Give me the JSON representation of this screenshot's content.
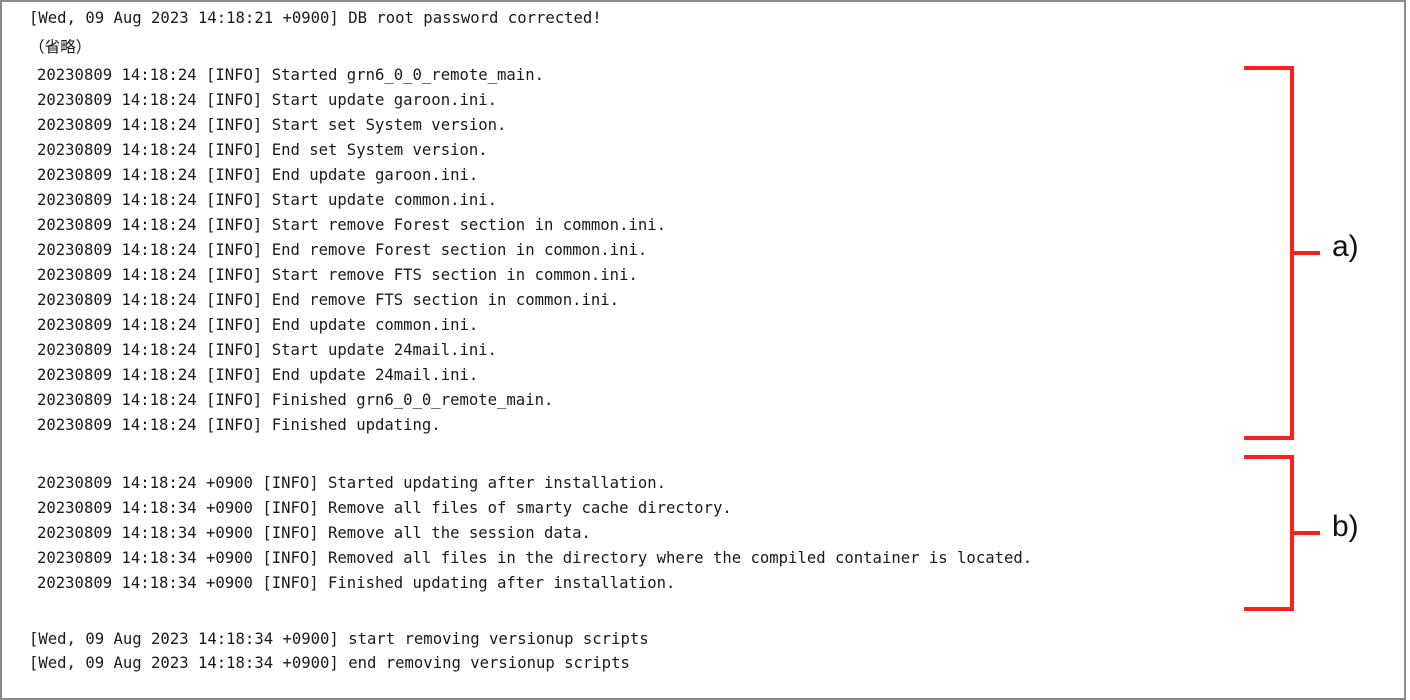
{
  "lines": {
    "header": "[Wed, 09 Aug 2023 14:18:21 +0900] DB root password corrected!",
    "omitted": "（省略）",
    "a": [
      "20230809 14:18:24 [INFO] Started grn6_0_0_remote_main.",
      "20230809 14:18:24 [INFO] Start update garoon.ini.",
      "20230809 14:18:24 [INFO] Start set System version.",
      "20230809 14:18:24 [INFO] End set System version.",
      "20230809 14:18:24 [INFO] End update garoon.ini.",
      "20230809 14:18:24 [INFO] Start update common.ini.",
      "20230809 14:18:24 [INFO] Start remove Forest section in common.ini.",
      "20230809 14:18:24 [INFO] End remove Forest section in common.ini.",
      "20230809 14:18:24 [INFO] Start remove FTS section in common.ini.",
      "20230809 14:18:24 [INFO] End remove FTS section in common.ini.",
      "20230809 14:18:24 [INFO] End update common.ini.",
      "20230809 14:18:24 [INFO] Start update 24mail.ini.",
      "20230809 14:18:24 [INFO] End update 24mail.ini.",
      "20230809 14:18:24 [INFO] Finished grn6_0_0_remote_main.",
      "20230809 14:18:24 [INFO] Finished updating."
    ],
    "b": [
      "20230809 14:18:24 +0900 [INFO] Started updating after installation.",
      "20230809 14:18:34 +0900 [INFO] Remove all files of smarty cache directory.",
      "20230809 14:18:34 +0900 [INFO] Remove all the session data.",
      "20230809 14:18:34 +0900 [INFO] Removed all files in the directory where the compiled container is located.",
      "20230809 14:18:34 +0900 [INFO] Finished updating after installation."
    ],
    "footer": [
      "[Wed, 09 Aug 2023 14:18:34 +0900] start removing versionup scripts",
      "[Wed, 09 Aug 2023 14:18:34 +0900] end removing versionup scripts"
    ]
  },
  "annotations": {
    "a_label": "a)",
    "b_label": "b)",
    "bracket_color": "#ff1f1f"
  }
}
